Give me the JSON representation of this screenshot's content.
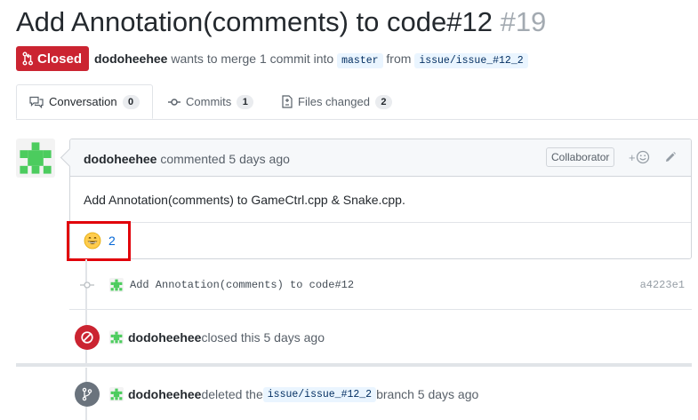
{
  "pr": {
    "title": "Add Annotation(comments) to code#12",
    "number": "#19",
    "state": "Closed",
    "author": "dodoheehee",
    "merge_text_1": " wants to merge 1 commit into ",
    "base_branch": "master",
    "merge_text_2": " from ",
    "head_branch": "issue/issue_#12_2"
  },
  "tabs": [
    {
      "label": "Conversation",
      "count": "0"
    },
    {
      "label": "Commits",
      "count": "1"
    },
    {
      "label": "Files changed",
      "count": "2"
    }
  ],
  "comment": {
    "author": "dodoheehee",
    "action": " commented 5 days ago",
    "role": "Collaborator",
    "body": "Add Annotation(comments) to GameCtrl.cpp & Snake.cpp.",
    "reaction_count": "2"
  },
  "commit": {
    "message": "Add Annotation(comments) to code#12",
    "sha": "a4223e1"
  },
  "events": {
    "closed_author": "dodoheehee",
    "closed_text": " closed this 5 days ago",
    "deleted_author": "dodoheehee",
    "deleted_text_1": " deleted the ",
    "deleted_branch": "issue/issue_#12_2",
    "deleted_text_2": " branch 5 days ago"
  },
  "colors": {
    "closed_red": "#cb2431",
    "link_blue": "#0366d6",
    "avatar_green": "#4ccc5e"
  }
}
